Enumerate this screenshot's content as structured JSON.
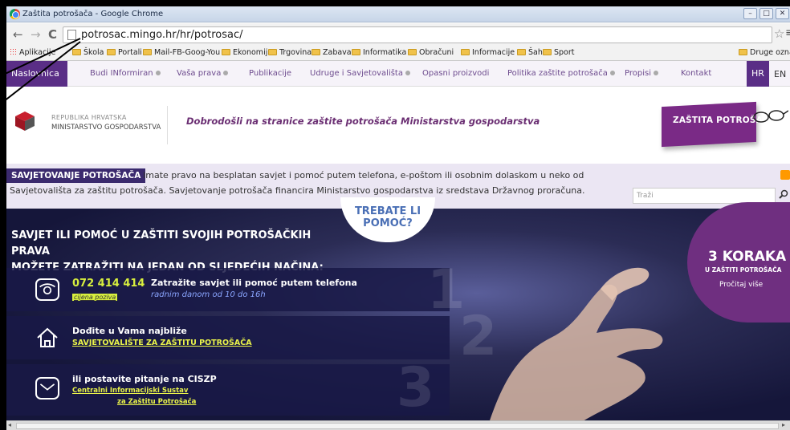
{
  "window": {
    "title": "Zaštita potrošača - Google Chrome",
    "minimize": "–",
    "maximize": "□",
    "close": "✕"
  },
  "toolbar": {
    "back": "←",
    "forward": "→",
    "reload": "C",
    "url": "potrosac.mingo.hr/hr/potrosac/",
    "star": "☆",
    "menu": "≡"
  },
  "bookmarks": [
    "Aplikacije",
    "Škola",
    "Portali",
    "Mail-FB-Goog-You",
    "Ekonomija",
    "Trgovina",
    "Zabava",
    "Informatika",
    "Obračuni",
    "Informacije",
    "Šah",
    "Sport"
  ],
  "bookmarks_other": "Druge oznake",
  "site_nav": {
    "home": "Naslovnica",
    "items": [
      "Budi INformiran",
      "Vaša prava",
      "Publikacije",
      "Udruge i Savjetovališta",
      "Opasni proizvodi",
      "Politika zaštite potrošača",
      "Propisi",
      "Kontakt"
    ],
    "lang_hr": "HR",
    "lang_en": "EN"
  },
  "header": {
    "logo_line1": "REPUBLIKA HRVATSKA",
    "logo_line2": "MINISTARSTVO GOSPODARSTVA",
    "welcome": "Dobrodošli na stranice zaštite potrošača Ministarstva gospodarstva",
    "badge": "ZAŠTITA POTROŠAČA"
  },
  "savjetovanje": {
    "tag": "SAVJETOVANJE POTROŠAČA",
    "line1": "Imate pravo na besplatan savjet i pomoć putem telefona, e-poštom ili osobnim dolaskom u neko od",
    "line2": "Savjetovališta za zaštitu potrošača. Savjetovanje potrošača financira Ministarstvo gospodarstva iz sredstava Državnog proračuna.",
    "search_placeholder": "Traži"
  },
  "hero": {
    "trebate1": "TREBATE LI",
    "trebate2": "POMOĆ?",
    "title_line1": "SAVJET ILI POMOĆ U ZAŠTITI SVOJIH POTROŠAČKIH PRAVA",
    "title_line2": "MOŽETE ZATRAŽITI NA JEDAN OD SLJEDEĆIH NAČINA:",
    "row1": {
      "phone": "072 414 414",
      "price": "cijena poziva",
      "main": "Zatražite savjet ili pomoć putem telefona",
      "sub": "radnim danom od 10 do 16h",
      "num": "1"
    },
    "row2": {
      "main": "Dođite u Vama najbliže",
      "link": "SAVJETOVALIŠTE ZA ZAŠTITU POTROŠAČA",
      "num": "2"
    },
    "row3": {
      "main": "ili postavite pitanje na CISZP",
      "link1": "Centralni Informacijski Sustav",
      "link2": "za Zaštitu Potrošača",
      "num": "3"
    },
    "koraka": {
      "title": "3 KORAKA",
      "sub": "U ZAŠTITI POTROŠAČA",
      "more": "Pročitaj više"
    }
  },
  "colors": {
    "purple": "#5a2e86",
    "accent_yellow": "#d8ef3e",
    "hero_bg": "#2b2c55"
  }
}
